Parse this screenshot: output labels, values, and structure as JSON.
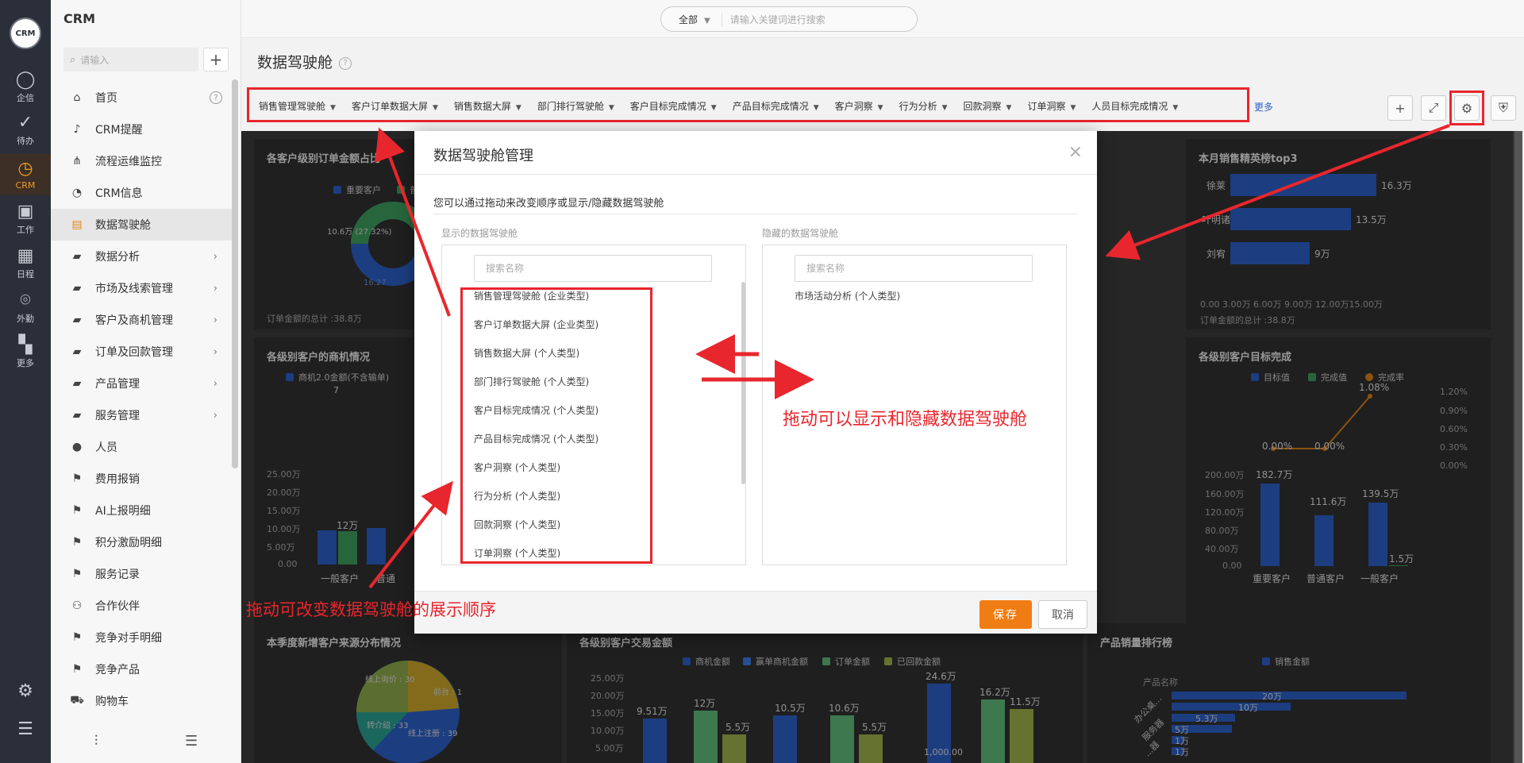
{
  "rail": {
    "logo": "CRM",
    "items": [
      {
        "label": "企信",
        "icon": "chat-bubble-icon"
      },
      {
        "label": "待办",
        "icon": "check-circle-icon"
      },
      {
        "label": "CRM",
        "icon": "clock-icon"
      },
      {
        "label": "工作",
        "icon": "briefcase-icon"
      },
      {
        "label": "日程",
        "icon": "calendar-icon"
      },
      {
        "label": "外勤",
        "icon": "location-pin-icon"
      },
      {
        "label": "更多",
        "icon": "grid-icon"
      }
    ]
  },
  "sidebar": {
    "brand": "CRM",
    "search_placeholder": "请输入",
    "add_label": "+",
    "items": [
      {
        "label": "首页",
        "icon": "home-icon",
        "help": "?"
      },
      {
        "label": "CRM提醒",
        "icon": "bell-icon"
      },
      {
        "label": "流程运维监控",
        "icon": "flow-icon"
      },
      {
        "label": "CRM信息",
        "icon": "pie-icon"
      },
      {
        "label": "数据驾驶舱",
        "icon": "dashboard-icon"
      },
      {
        "label": "数据分析",
        "icon": "folder-icon",
        "arrow": "›"
      },
      {
        "label": "市场及线索管理",
        "icon": "folder-icon",
        "arrow": "›"
      },
      {
        "label": "客户及商机管理",
        "icon": "folder-icon",
        "arrow": "›"
      },
      {
        "label": "订单及回款管理",
        "icon": "folder-icon",
        "arrow": "›"
      },
      {
        "label": "产品管理",
        "icon": "folder-icon",
        "arrow": "›"
      },
      {
        "label": "服务管理",
        "icon": "folder-icon",
        "arrow": "›"
      },
      {
        "label": "人员",
        "icon": "person-icon"
      },
      {
        "label": "费用报销",
        "icon": "flag-icon"
      },
      {
        "label": "AI上报明细",
        "icon": "flag-icon"
      },
      {
        "label": "积分激励明细",
        "icon": "flag-icon"
      },
      {
        "label": "服务记录",
        "icon": "flag-icon"
      },
      {
        "label": "合作伙伴",
        "icon": "partners-icon"
      },
      {
        "label": "竞争对手明细",
        "icon": "flag-icon"
      },
      {
        "label": "竞争产品",
        "icon": "flag-icon"
      },
      {
        "label": "购物车",
        "icon": "cart-icon"
      }
    ]
  },
  "topbar": {
    "scope": "全部",
    "search_placeholder": "请输入关键词进行搜索"
  },
  "page": {
    "title": "数据驾驶舱",
    "help": "?",
    "more": "更多",
    "tabs": [
      "销售管理驾驶舱",
      "客户订单数据大屏",
      "销售数据大屏",
      "部门排行驾驶舱",
      "客户目标完成情况",
      "产品目标完成情况",
      "客户洞察",
      "行为分析",
      "回款洞察",
      "订单洞察",
      "人员目标完成情况"
    ]
  },
  "panels": {
    "p1": {
      "title": "各客户级别订单金额占比",
      "legend": [
        "重要客户",
        "普通"
      ],
      "label_a": "10.6万 (27.32%)",
      "label_b": "16.27",
      "footer": "订单金额的总计 :38.8万"
    },
    "p2": {
      "title": "本月销售精英榜top3",
      "names": [
        "徐莱",
        "叶明诸",
        "刘宥"
      ],
      "values_text": [
        "16.3万",
        "13.5万",
        "9万"
      ],
      "ticks": "0.00  3.00万 6.00万 9.00万 12.00万15.00万",
      "footer": "订单金额的总计 :38.8万"
    },
    "p3": {
      "title": "各级别客户的商机情况",
      "legend": "商机2.0金额(不含输单)",
      "top_val": "7",
      "yticks": [
        "25.00万",
        "20.00万",
        "15.00万",
        "10.00万",
        "5.00万",
        "0.00"
      ],
      "bar_label": "12万",
      "xlabels": [
        "一般客户",
        "普通"
      ]
    },
    "p4": {
      "title": "各级别客户目标完成",
      "legend": [
        "目标值",
        "完成值",
        "完成率"
      ],
      "rticks": [
        "1.20%",
        "0.90%",
        "0.60%",
        "0.30%",
        "0.00%"
      ],
      "rate_labels": [
        "0.00%",
        "0.00%",
        "1.08%"
      ],
      "yticks": [
        "200.00万",
        "160.00万",
        "120.00万",
        "80.00万",
        "40.00万",
        "0.00"
      ],
      "bar_labels": [
        "182.7万",
        "111.6万",
        "139.5万",
        "1.5万"
      ],
      "xlabels": [
        "重要客户",
        "普通客户",
        "一般客户"
      ]
    },
    "p5": {
      "title": "本季度新增客户来源分布情况",
      "labels": [
        "线上询价 : 30",
        "转介绍 : 33",
        "线上注册 : 39",
        "前台 : 1"
      ]
    },
    "p6": {
      "title": "各级别客户交易金额",
      "legend": [
        "商机金额",
        "赢单商机金额",
        "订单金额",
        "已回款金额"
      ],
      "yticks": [
        "25.00万",
        "20.00万",
        "15.00万",
        "10.00万",
        "5.00万"
      ],
      "bar_labels": [
        "9.51万",
        "12万",
        "5.5万",
        "10.5万",
        "10.6万",
        "5.5万",
        "24.6万",
        "16.2万",
        "11.5万",
        "1,000.00"
      ]
    },
    "p7": {
      "title": "产品销量排行榜",
      "legend": "销售金额",
      "axis_title": "产品名称",
      "bar_labels": [
        "20万",
        "10万",
        "5.3万",
        "5万",
        "1万",
        "1万"
      ],
      "cats": [
        "办公桌...",
        "服务器",
        "...器"
      ]
    }
  },
  "dialog": {
    "title": "数据驾驶舱管理",
    "close": "×",
    "desc": "您可以通过拖动来改变顺序或显示/隐藏数据驾驶舱",
    "shown_label": "显示的数据驾驶舱",
    "hidden_label": "隐藏的数据驾驶舱",
    "search_placeholder": "搜索名称",
    "shown_items": [
      "销售管理驾驶舱 (企业类型)",
      "客户订单数据大屏 (企业类型)",
      "销售数据大屏 (个人类型)",
      "部门排行驾驶舱 (个人类型)",
      "客户目标完成情况 (个人类型)",
      "产品目标完成情况 (个人类型)",
      "客户洞察 (个人类型)",
      "行为分析 (个人类型)",
      "回款洞察 (个人类型)",
      "订单洞察 (个人类型)"
    ],
    "hidden_items": [
      "市场活动分析 (个人类型)"
    ],
    "save": "保存",
    "cancel": "取消"
  },
  "annotations": {
    "drag_show_hide": "拖动可以显示和隐藏数据驾驶舱",
    "drag_order": "拖动可改变数据驾驶舱的展示顺序"
  },
  "colors": {
    "accent": "#f07d14",
    "highlight": "#e8262d",
    "blue": "#2c5fc4",
    "green": "#3c9d5d",
    "orange": "#d8801a",
    "link": "#2e63c9"
  }
}
